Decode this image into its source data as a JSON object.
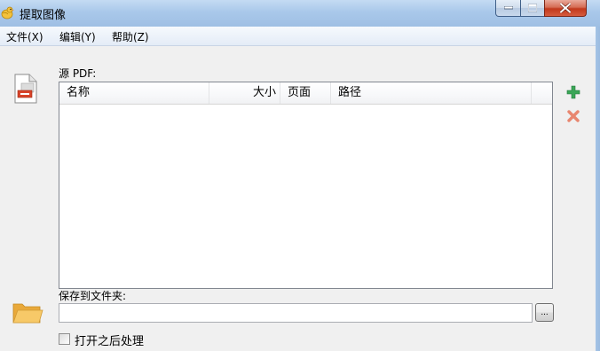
{
  "window": {
    "title": "提取图像",
    "icon": "bird-app-icon"
  },
  "menu": {
    "file": "文件(X)",
    "edit": "编辑(Y)",
    "help": "帮助(Z)"
  },
  "source": {
    "label": "源 PDF:",
    "columns": [
      "名称",
      "大小",
      "页面",
      "路径"
    ],
    "rows": []
  },
  "output": {
    "label": "保存到文件夹:",
    "value": "",
    "browse_label": "..."
  },
  "options": {
    "open_after_label": "打开之后处理",
    "open_after_checked": false
  },
  "colors": {
    "titlebar": "#a9c8ea",
    "close_button": "#c2391c",
    "add_icon": "#3aa657",
    "remove_icon": "#e8866f",
    "folder": "#f2b84b"
  }
}
